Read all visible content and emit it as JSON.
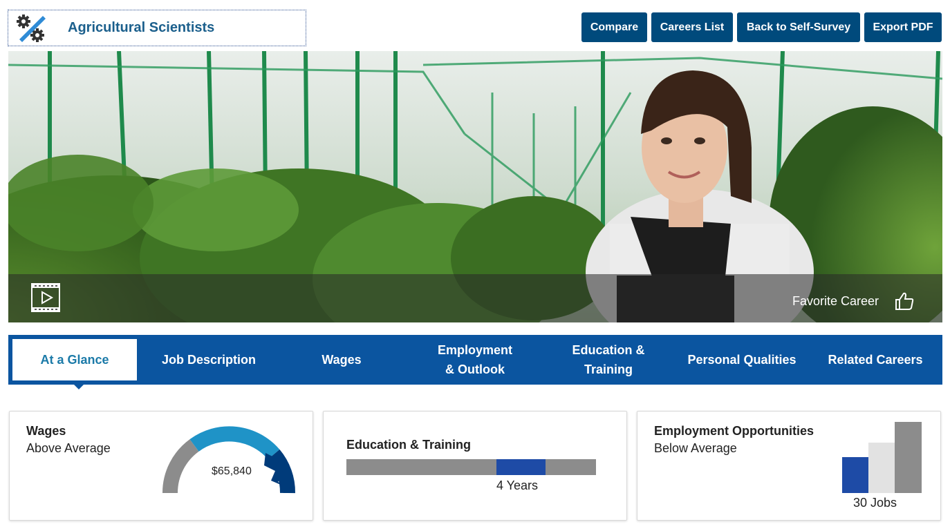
{
  "header": {
    "title": "Agricultural Scientists",
    "buttons": [
      "Compare",
      "Careers List",
      "Back to Self-Survey",
      "Export PDF"
    ]
  },
  "hero": {
    "favorite_label": "Favorite Career"
  },
  "tabs": [
    {
      "label": "At a Glance",
      "active": true
    },
    {
      "label": "Job Description"
    },
    {
      "label": "Wages"
    },
    {
      "label": "Employment & Outlook"
    },
    {
      "label": "Education & Training"
    },
    {
      "label": "Personal Qualities"
    },
    {
      "label": "Related Careers"
    }
  ],
  "cards": {
    "wages": {
      "title": "Wages",
      "subtitle": "Above Average",
      "value": "$65,840"
    },
    "education": {
      "title": "Education & Training",
      "value": "4 Years"
    },
    "employment": {
      "title": "Employment Opportunities",
      "subtitle": "Below Average",
      "value": "30 Jobs"
    }
  },
  "colors": {
    "primary": "#004a7c",
    "tab_bar": "#0b55a0",
    "accent_blue": "#1f93c7",
    "dark_blue": "#003b7a",
    "marker_blue": "#1e4ba6",
    "gray": "#8c8c8c"
  }
}
